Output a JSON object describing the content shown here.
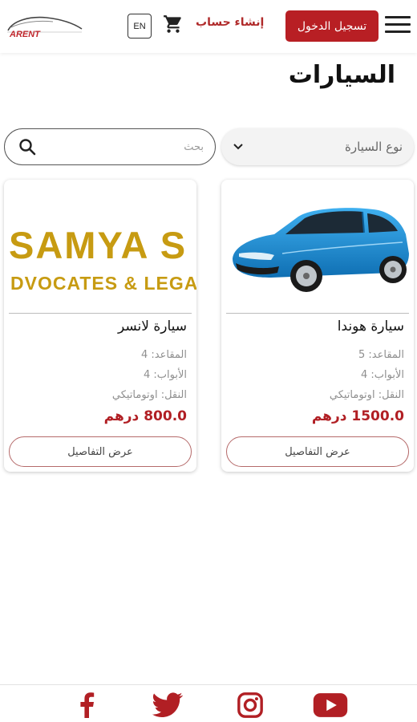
{
  "header": {
    "logo_text": "ARENT",
    "lang_label": "EN",
    "register_label": "إنشاء حساب",
    "login_label": "تسجيل الدخول",
    "cart_icon": "cart-icon",
    "menu_icon": "hamburger-menu-icon"
  },
  "page": {
    "title": "السيارات"
  },
  "filters": {
    "type_label": "نوع السيارة",
    "search_placeholder": "بحث"
  },
  "cars": [
    {
      "name": "سيارة هوندا",
      "seats": "المقاعد: 5",
      "doors": "الأبواب: 4",
      "transmission": "النقل: اوتوماتيكي",
      "price": "1500.0 درهم",
      "details_label": "عرض التفاصيل",
      "image_color": "#1c8fd6"
    },
    {
      "name": "سيارة لانسر",
      "seats": "المقاعد: 4",
      "doors": "الأبواب: 4",
      "transmission": "النقل: اوتوماتيكي",
      "price": "800.0 درهم",
      "details_label": "عرض التفاصيل",
      "image_text_1": "SAMYA S",
      "image_text_2": "DVOCATES & LEGAL"
    }
  ],
  "footer": {
    "social": [
      "facebook-icon",
      "twitter-icon",
      "instagram-icon",
      "youtube-icon"
    ],
    "color": "#b11f24"
  },
  "colors": {
    "accent": "#b81f24",
    "price": "#b11f24",
    "logo_gold": "#c79b12"
  }
}
